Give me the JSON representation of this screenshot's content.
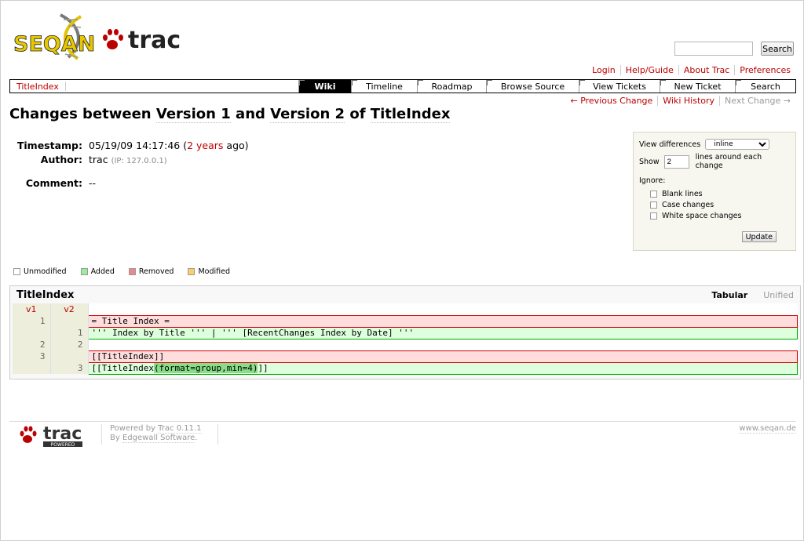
{
  "header": {
    "logo_text": "SEQAN",
    "trac_text": "trac",
    "search": {
      "placeholder": "",
      "value": "",
      "button_label": "Search"
    }
  },
  "metanav": [
    "Login",
    "Help/Guide",
    "About Trac",
    "Preferences"
  ],
  "mainnav": {
    "title": "TitleIndex",
    "items": [
      "Wiki",
      "Timeline",
      "Roadmap",
      "Browse Source",
      "View Tickets",
      "New Ticket",
      "Search"
    ],
    "active": "Wiki"
  },
  "ctxtnav": {
    "prev": "← Previous Change",
    "history": "Wiki History",
    "next": "Next Change →"
  },
  "page": {
    "title_prefix": "Changes between ",
    "v1": "Version 1",
    "and": " and ",
    "v2": "Version 2",
    "of": " of ",
    "name": "TitleIndex"
  },
  "overview": {
    "timestamp_label": "Timestamp:",
    "timestamp_value": "05/19/09 14:17:46 (",
    "timestamp_link": "2 years",
    "timestamp_suffix": " ago)",
    "author_label": "Author:",
    "author_value": "trac",
    "author_ip": "(IP: 127.0.0.1)",
    "comment_label": "Comment:",
    "comment_value": "--"
  },
  "prefs": {
    "view_label": "View differences",
    "view_value": "inline",
    "show_label": "Show",
    "context_value": "2",
    "context_suffix": "lines around each change",
    "ignore_label": "Ignore:",
    "ignore_options": [
      "Blank lines",
      "Case changes",
      "White space changes"
    ],
    "update_label": "Update"
  },
  "legend": [
    {
      "label": "Unmodified",
      "color": "#ffffff"
    },
    {
      "label": "Added",
      "color": "#99ee99"
    },
    {
      "label": "Removed",
      "color": "#ee8888"
    },
    {
      "label": "Modified",
      "color": "#ffcc66"
    }
  ],
  "diff": {
    "filename": "TitleIndex",
    "view_tabular": "Tabular",
    "view_unified": "Unified",
    "col_v1": "v1",
    "col_v2": "v2",
    "rows": [
      {
        "v1": "1",
        "v2": "",
        "code": "= Title Index ="
      },
      {
        "v1": "",
        "v2": "1",
        "code": "''' Index by Title ''' | ''' [RecentChanges Index by Date] '''"
      },
      {
        "v1": "2",
        "v2": "2",
        "code": ""
      },
      {
        "v1": "3",
        "v2": "",
        "code": "[[TitleIndex]]"
      },
      {
        "v1": "",
        "v2": "3",
        "code_pre": "[[TitleIndex",
        "code_hl": "(format=group,min=4)",
        "code_post": "]]"
      }
    ]
  },
  "footer": {
    "powered_by": "Powered by ",
    "trac_version": "Trac 0.11.1",
    "by": "By ",
    "edgewall": "Edgewall Software",
    "by_end": ".",
    "site": "www.seqan.de",
    "logo_badge": "POWERED"
  }
}
